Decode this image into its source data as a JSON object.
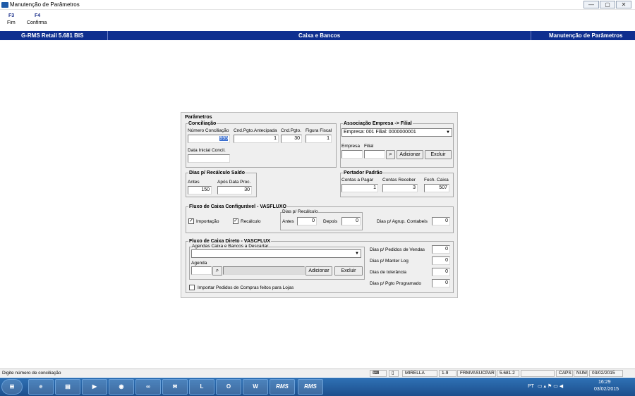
{
  "window": {
    "title": "Manutenção de Parâmetros",
    "min": "—",
    "max": "▢",
    "close": "✕"
  },
  "fkeys": [
    {
      "key": "F3",
      "label": "Fim"
    },
    {
      "key": "F4",
      "label": "Confirma"
    }
  ],
  "band": {
    "left": "G-RMS Retail 5.681 BIS",
    "center": "Caixa e Bancos",
    "right": "Manutenção de Parâmetros"
  },
  "parametros": {
    "title": "Parâmetros",
    "conciliacao": {
      "title": "Conciliação",
      "numero_label": "Número Conciliação",
      "numero_value": "995",
      "cnd_antecipada_label": "Cnd.Pgto.Antecipada",
      "cnd_antecipada_value": "1",
      "cnd_pgto_label": "Cnd.Pgto.",
      "cnd_pgto_value": "30",
      "figura_fiscal_label": "Figura Fiscal",
      "figura_fiscal_value": "1",
      "data_inicial_label": "Data Inicial Concil.",
      "data_inicial_value": ""
    },
    "associacao": {
      "title": "Associação Empresa -> Filial",
      "select_value": "Empresa: 001 Filial: 0000000001",
      "empresa_label": "Empresa",
      "filial_label": "Filial",
      "adicionar": "Adicionar",
      "excluir": "Excluir"
    },
    "dias_recalculo": {
      "title": "Dias p/ Recálculo Saldo",
      "antes_label": "Antes",
      "antes_value": "150",
      "apos_label": "Após Data Proc.",
      "apos_value": "30"
    },
    "portador": {
      "title": "Portador Padrão",
      "pagar_label": "Contas a Pagar",
      "pagar_value": "1",
      "receber_label": "Contas Receber",
      "receber_value": "3",
      "caixa_label": "Fech. Caixa",
      "caixa_value": "507"
    },
    "fluxo_config": {
      "title": "Fluxo de Caixa Configurável - VASFLUXO",
      "importacao": "Importação",
      "recalculo": "Recálculo",
      "dias_title": "Dias p/ Recálculo",
      "antes_label": "Antes",
      "antes_value": "0",
      "depois_label": "Depois",
      "depois_value": "0",
      "agrup_label": "Dias p/ Agrup. Contabeis",
      "agrup_value": "0"
    },
    "fluxo_direto": {
      "title": "Fluxo de Caixa Direto - VASCFLUX",
      "agendas_title": "Agendas Caixa e Bancos a Descartar",
      "agenda_label": "Agenda",
      "adicionar": "Adicionar",
      "excluir": "Excluir",
      "importar_label": "Importar Pedidos de Compras feitos para Lojas",
      "pedidos_label": "Dias p/ Pedidos de Vendas",
      "pedidos_value": "0",
      "log_label": "Dias p/ Manter Log",
      "log_value": "0",
      "tolerancia_label": "Dias de tolerância",
      "tolerancia_value": "0",
      "pgto_label": "Dias p/ Pgto Programado",
      "pgto_value": "0"
    }
  },
  "status": {
    "message": "Digite número de conciliação",
    "user": "MIRELLA",
    "range": "1-9",
    "program": "FRMVASUCPAR",
    "version": "5.681.2",
    "caps": "CAPS",
    "num": "NUM",
    "date": "03/02/2015"
  },
  "taskbar": {
    "lang": "PT",
    "time": "16:29",
    "date": "03/02/2015",
    "apps": [
      "⊞",
      "e",
      "▤",
      "▶",
      "◉",
      "∞",
      "✉",
      "L",
      "O",
      "W",
      "RMS",
      "RMS"
    ]
  }
}
